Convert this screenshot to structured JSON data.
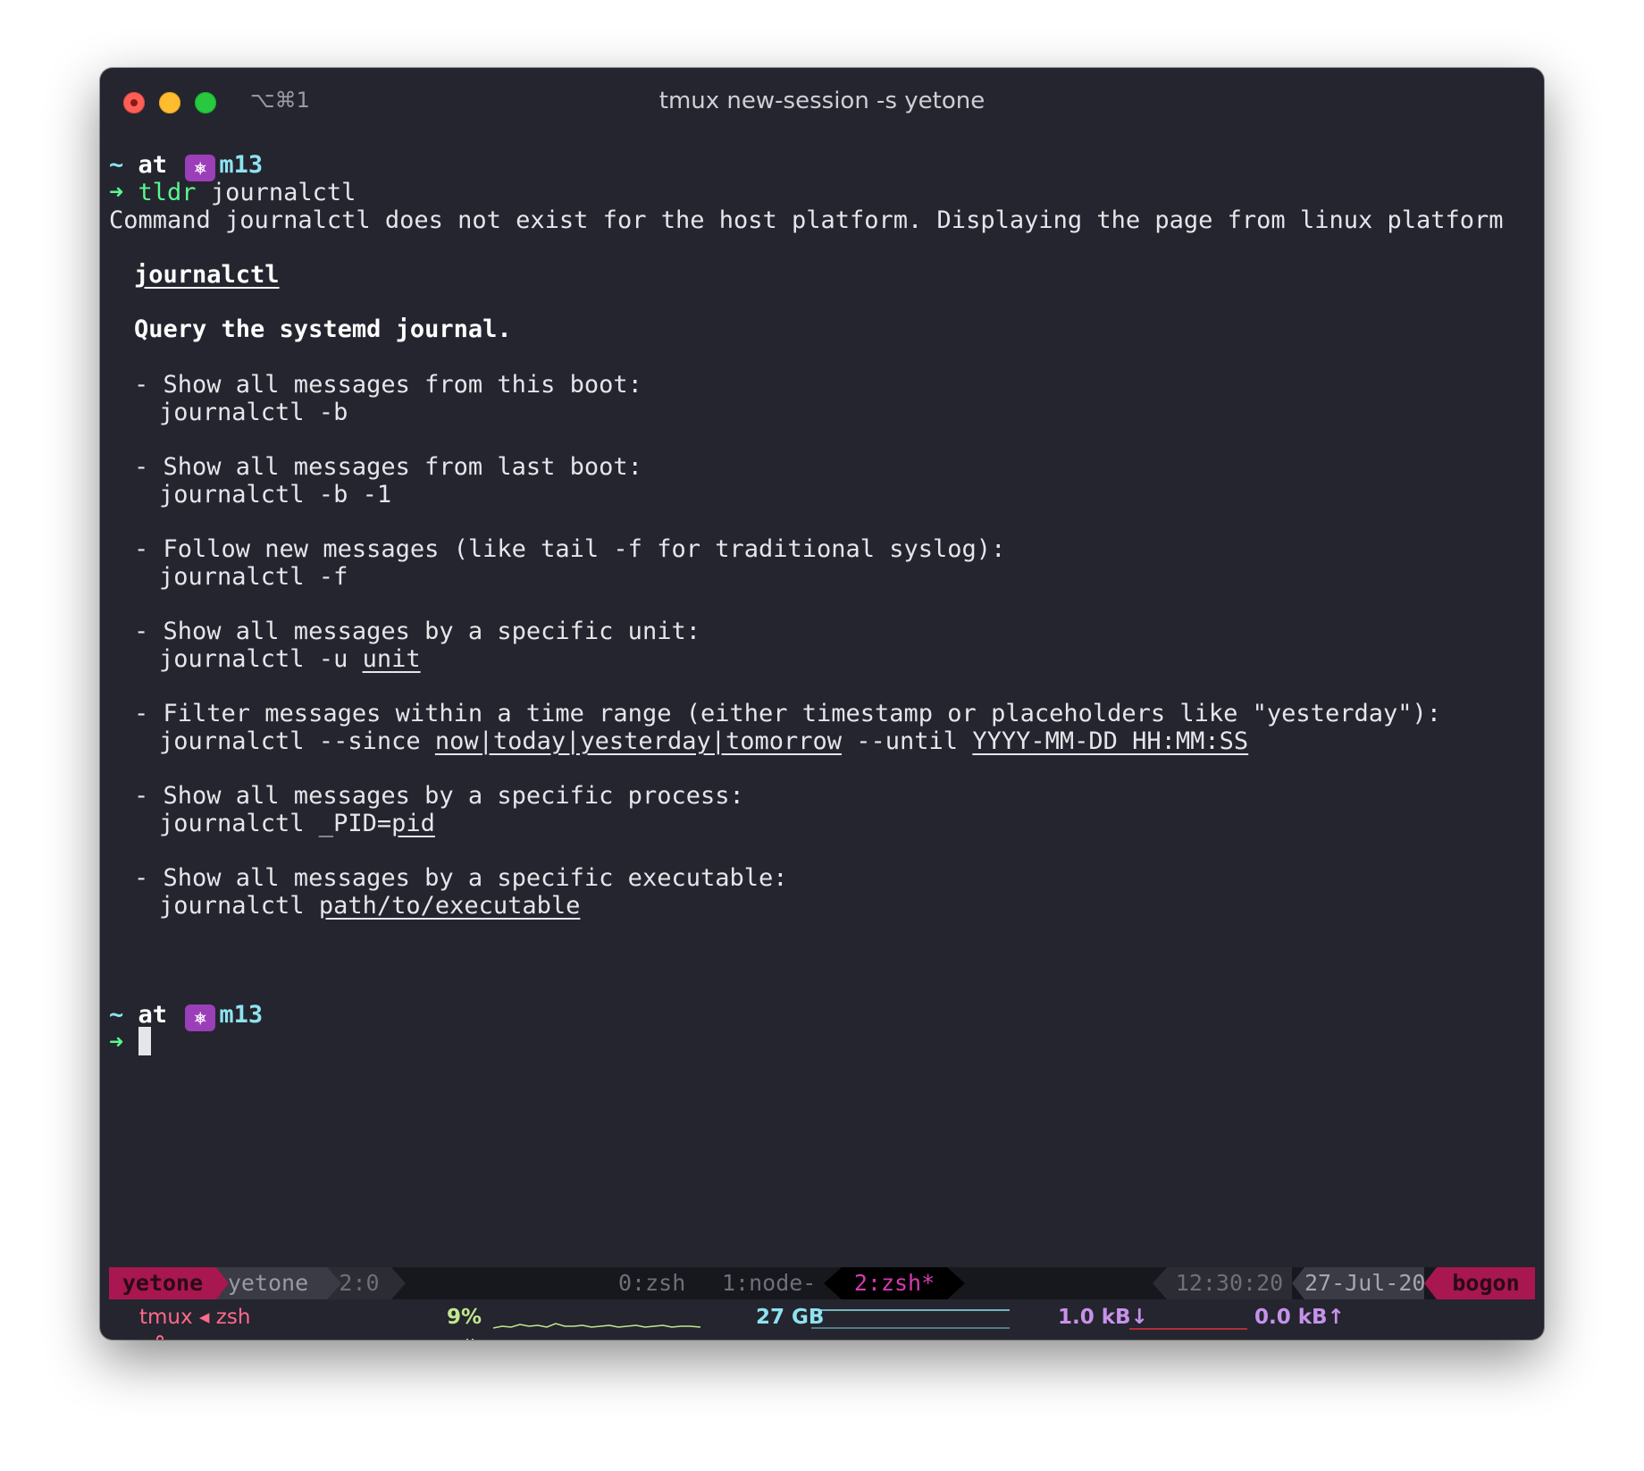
{
  "window": {
    "title": "tmux new-session -s yetone",
    "shortcut": "⌥⌘1"
  },
  "prompt": {
    "dir": "~",
    "at": "at",
    "icon": "⎈",
    "context": "m13",
    "arrow": "➜"
  },
  "command": {
    "name": "tldr",
    "arg": "journalctl"
  },
  "notice": "Command journalctl does not exist for the host platform. Displaying the page from linux platform",
  "page": {
    "title": "journalctl",
    "description": "Query the systemd journal.",
    "examples": [
      {
        "desc": "- Show all messages from this boot:",
        "cmd": "journalctl -b"
      },
      {
        "desc": "- Show all messages from last boot:",
        "cmd": "journalctl -b -1"
      },
      {
        "desc": "- Follow new messages (like tail -f for traditional syslog):",
        "cmd": "journalctl -f"
      },
      {
        "desc": "- Show all messages by a specific unit:",
        "cmd_prefix": "journalctl -u ",
        "cmd_arg": "unit"
      },
      {
        "desc": "- Filter messages within a time range (either timestamp or placeholders like \"yesterday\"):",
        "cmd_prefix": "journalctl --since ",
        "cmd_arg": "now|today|yesterday|tomorrow",
        "cmd_mid": " --until ",
        "cmd_arg2": "YYYY-MM-DD HH:MM:SS"
      },
      {
        "desc": "- Show all messages by a specific process:",
        "cmd_prefix": "journalctl _PID=",
        "cmd_arg": "pid"
      },
      {
        "desc": "- Show all messages by a specific executable:",
        "cmd_prefix": "journalctl ",
        "cmd_arg": "path/to/executable"
      }
    ]
  },
  "tmux": {
    "session": "yetone",
    "user": "yetone",
    "pane": "2:0",
    "windows": [
      "0:zsh",
      "1:node-",
      "2:zsh*"
    ],
    "time": "12:30:20",
    "date": "27-Jul-20",
    "host": "bogon",
    "process": "tmux ◂ zsh",
    "cpu": "9%",
    "memory": "27 GB",
    "net_down": "1.0 kB↓",
    "net_up": "0.0 kB↑",
    "colors": {
      "accent": "#a8174f",
      "active_window": "#d63bb3",
      "cpu": "#c3e88d",
      "mem": "#8ee3ef",
      "net": "#c792ea"
    },
    "icons": {
      "branch": "branch-icon",
      "cpu": "cpu-chip-icon",
      "memory": "memory-icon",
      "network": "network-icon"
    }
  }
}
